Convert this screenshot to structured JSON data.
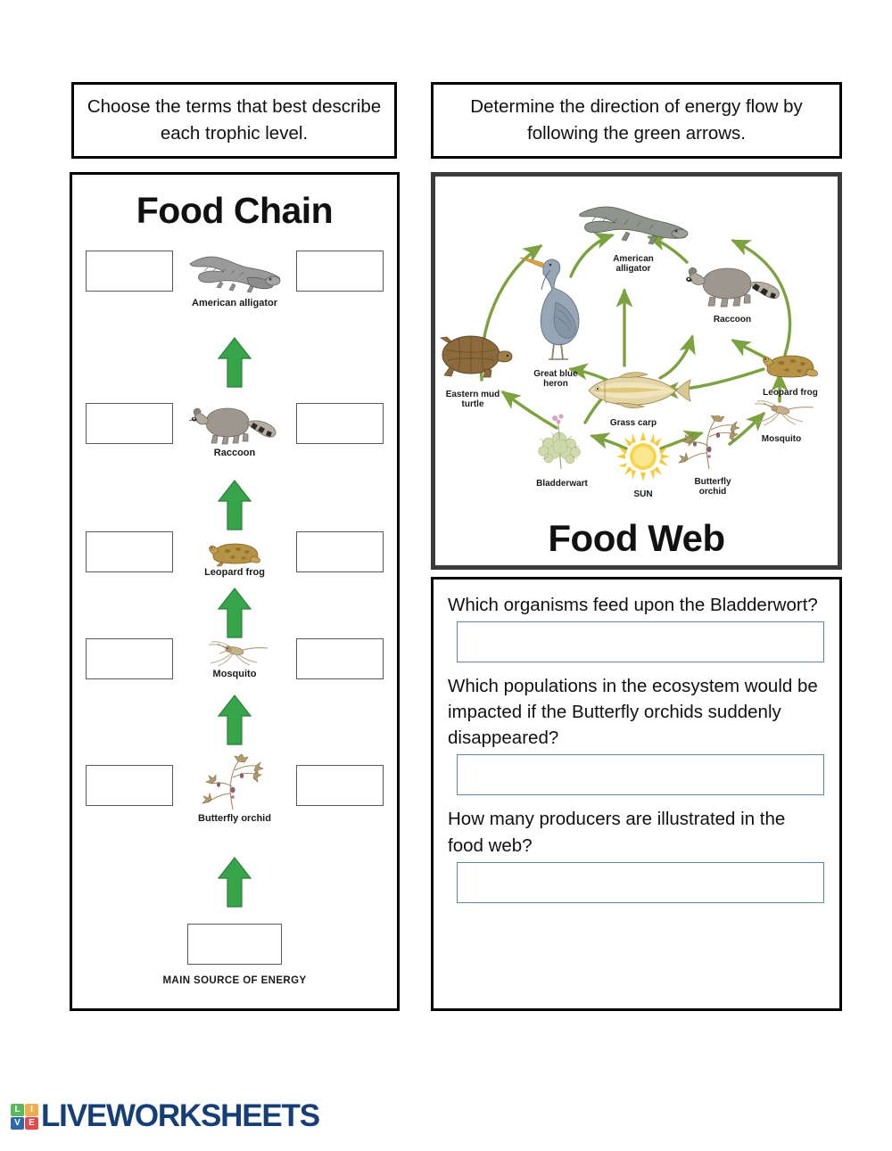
{
  "instructions": {
    "left": "Choose the terms that best describe each trophic level.",
    "right": "Determine the direction of energy flow by following the green arrows."
  },
  "food_chain": {
    "title": "Food Chain",
    "energy_source_label": "MAIN SOURCE OF ENERGY",
    "levels": [
      {
        "organism": "American alligator",
        "left_blank": "",
        "right_blank": ""
      },
      {
        "organism": "Raccoon",
        "left_blank": "",
        "right_blank": ""
      },
      {
        "organism": "Leopard frog",
        "left_blank": "",
        "right_blank": ""
      },
      {
        "organism": "Mosquito",
        "left_blank": "",
        "right_blank": ""
      },
      {
        "organism": "Butterfly orchid",
        "left_blank": "",
        "right_blank": ""
      }
    ],
    "energy_source_blank": ""
  },
  "food_web": {
    "title": "Food Web",
    "organisms": [
      "American alligator",
      "Raccoon",
      "Leopard frog",
      "Mosquito",
      "Butterfly orchid",
      "Bladderwart",
      "SUN",
      "Grass carp",
      "Great blue heron",
      "Eastern mud turtle"
    ]
  },
  "questions": [
    {
      "text": "Which organisms feed upon the Bladderwort?",
      "answer": "",
      "placeholder": ""
    },
    {
      "text": "Which populations in the ecosystem would be impacted if the Butterfly orchids suddenly disappeared?",
      "answer": "",
      "placeholder": ""
    },
    {
      "text": "How many producers are illustrated in the food web?",
      "answer": "",
      "placeholder": ""
    }
  ],
  "footer": {
    "brand": "LIVEWORKSHEETS",
    "tiles": [
      {
        "letter": "L",
        "color": "#5cb85c"
      },
      {
        "letter": "I",
        "color": "#f0ad4e"
      },
      {
        "letter": "V",
        "color": "#2f6aa8"
      },
      {
        "letter": "E",
        "color": "#e04a4a"
      }
    ]
  },
  "colors": {
    "arrow_green": "#36a54a",
    "arrow_green_dark": "#2b7f39",
    "web_arrow": "#7ba23f",
    "sun": "#f2c430",
    "input_border": "#5b87ad",
    "panel_border": "#000000",
    "web_panel_border": "#3b3b3b"
  }
}
